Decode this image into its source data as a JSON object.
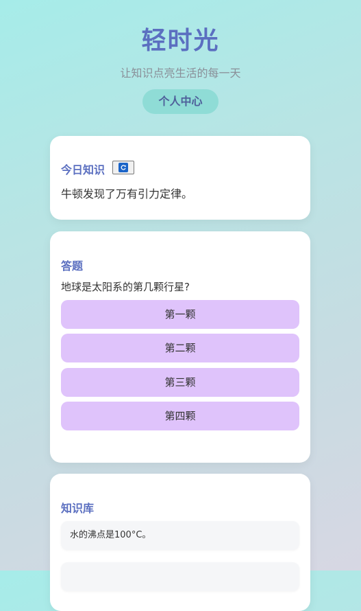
{
  "header": {
    "title": "轻时光",
    "subtitle": "让知识点亮生活的每一天",
    "profile_button": "个人中心"
  },
  "today": {
    "title": "今日知识",
    "refresh_icon": "refresh-icon",
    "text": "牛顿发现了万有引力定律。"
  },
  "quiz": {
    "title": "答题",
    "question": "地球是太阳系的第几颗行星?",
    "options": [
      "第一颗",
      "第二颗",
      "第三颗",
      "第四颗"
    ]
  },
  "library": {
    "title": "知识库",
    "items": [
      "水的沸点是100°C。",
      ""
    ]
  },
  "colors": {
    "accent": "#5b6fc0",
    "option_bg": "#dfc3fb",
    "profile_btn_bg": "#8fdcd6"
  }
}
